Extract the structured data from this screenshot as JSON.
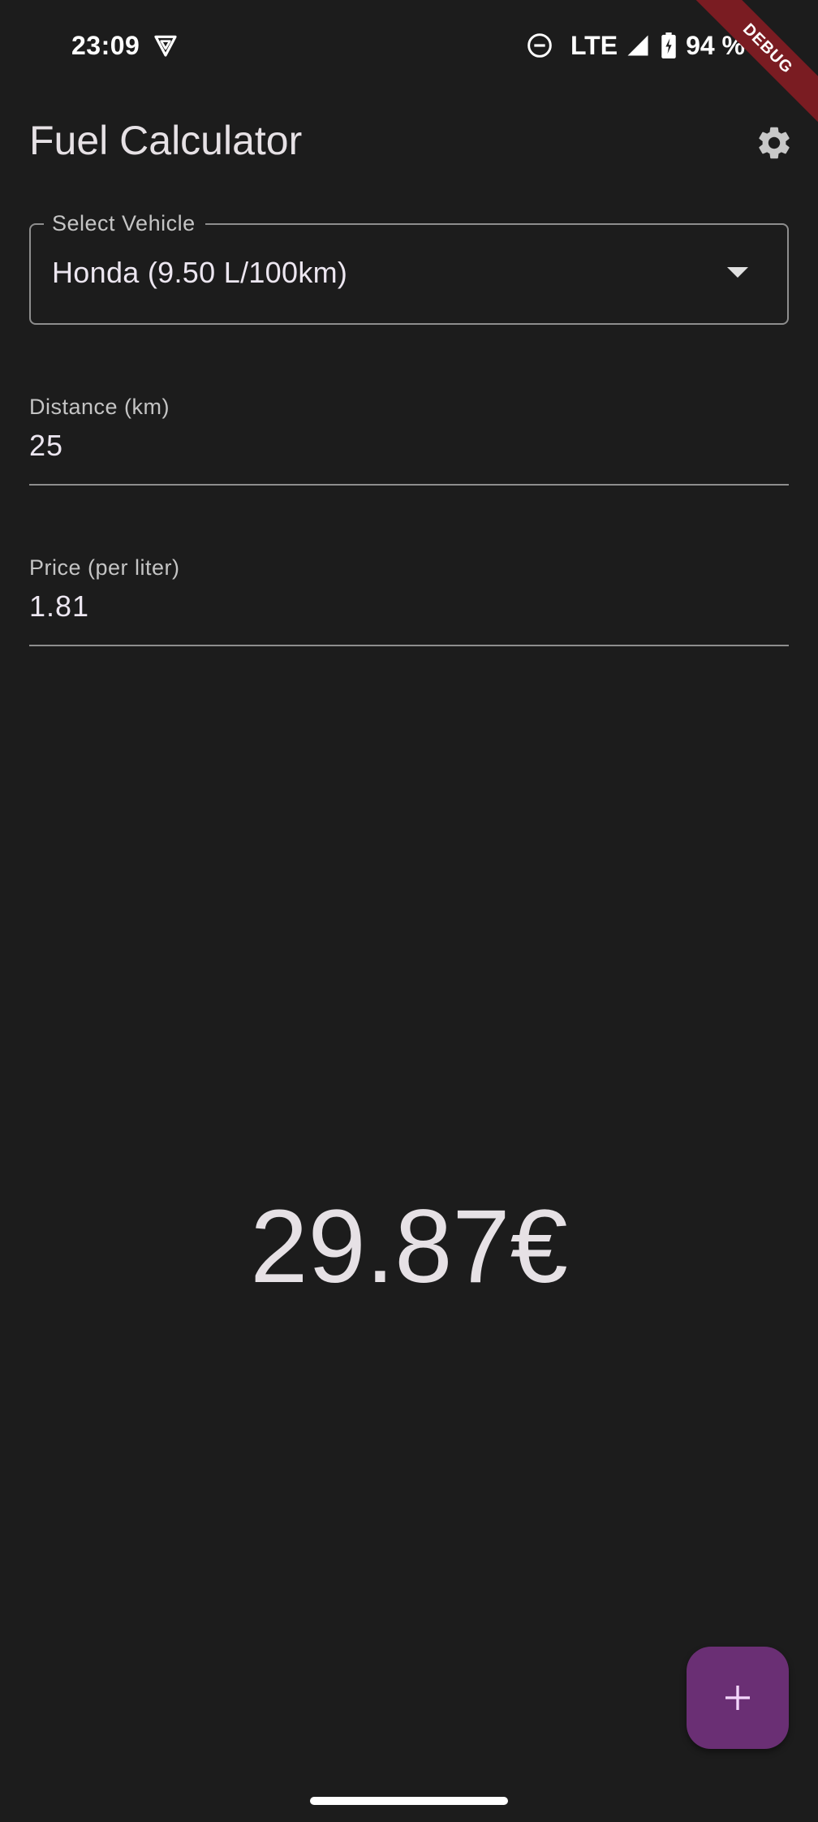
{
  "status_bar": {
    "time": "23:09",
    "network": "LTE",
    "battery": "94 %"
  },
  "debug_banner": "DEBUG",
  "app_bar": {
    "title": "Fuel Calculator"
  },
  "vehicle_select": {
    "label": "Select Vehicle",
    "value": "Honda (9.50 L/100km)"
  },
  "distance": {
    "label": "Distance (km)",
    "value": "25"
  },
  "price": {
    "label": "Price (per liter)",
    "value": "1.81"
  },
  "result": "29.87€",
  "colors": {
    "background": "#1c1c1c",
    "fab": "#6a2f74",
    "debug_ribbon": "#7a1c22"
  },
  "icons": {
    "status_vpn": "vpn-key-icon",
    "status_dnd": "do-not-disturb-icon",
    "status_signal": "signal-icon",
    "status_battery": "battery-charging-icon",
    "settings": "gear-icon",
    "dropdown": "arrow-drop-down-icon",
    "fab": "plus-icon"
  }
}
